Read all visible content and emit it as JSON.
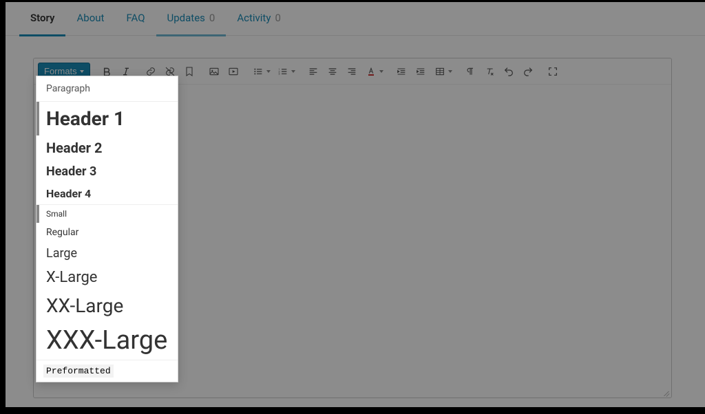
{
  "tabs": [
    {
      "label": "Story",
      "count": null,
      "active": true
    },
    {
      "label": "About",
      "count": null,
      "active": false
    },
    {
      "label": "FAQ",
      "count": null,
      "active": false
    },
    {
      "label": "Updates",
      "count": "0",
      "active": false,
      "secondary_underline": true
    },
    {
      "label": "Activity",
      "count": "0",
      "active": false
    }
  ],
  "toolbar": {
    "formats_label": "Formats"
  },
  "formats_dropdown": {
    "paragraph": "Paragraph",
    "h1": "Header 1",
    "h2": "Header 2",
    "h3": "Header 3",
    "h4": "Header 4",
    "small": "Small",
    "regular": "Regular",
    "large": "Large",
    "xlarge": "X-Large",
    "xxlarge": "XX-Large",
    "xxxlarge": "XXX-Large",
    "preformatted": "Preformatted"
  }
}
